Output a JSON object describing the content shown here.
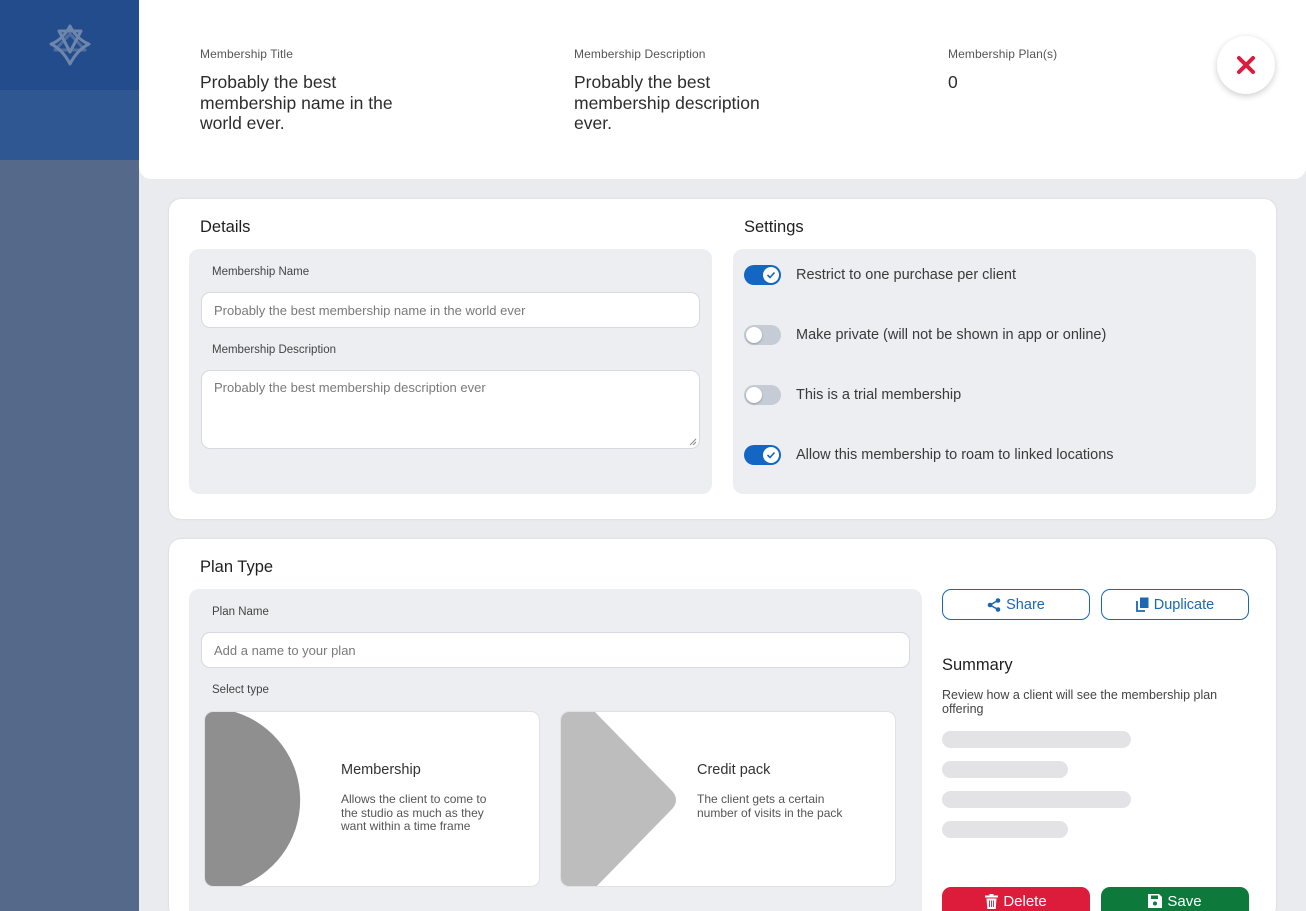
{
  "header": {
    "title_label": "Membership Title",
    "title_value": "Probably the best membership name in the world ever.",
    "desc_label": "Membership Description",
    "desc_value": "Probably the best membership description ever.",
    "plans_label": "Membership Plan(s)",
    "plans_value": "0"
  },
  "details": {
    "heading": "Details",
    "name_label": "Membership Name",
    "name_placeholder": "Probably the best membership name in the world ever",
    "desc_label": "Membership Description",
    "desc_placeholder": "Probably the best membership description ever"
  },
  "settings": {
    "heading": "Settings",
    "items": [
      {
        "label": "Restrict to one purchase per client",
        "enabled": true
      },
      {
        "label": "Make private (will not be shown in app or online)",
        "enabled": false
      },
      {
        "label": "This is a trial membership",
        "enabled": false
      },
      {
        "label": "Allow this membership to roam to linked locations",
        "enabled": true
      }
    ]
  },
  "plan": {
    "heading": "Plan Type",
    "name_label": "Plan Name",
    "name_placeholder": "Add a name to your plan",
    "select_label": "Select type",
    "types": [
      {
        "title": "Membership",
        "description": "Allows the client to come to the studio as much as they want within a time frame"
      },
      {
        "title": "Credit pack",
        "description": "The client gets a certain number of visits in the pack"
      }
    ]
  },
  "actions": {
    "share_label": "Share",
    "duplicate_label": "Duplicate",
    "delete_label": "Delete",
    "save_label": "Save"
  },
  "summary": {
    "heading": "Summary",
    "description": "Review how a client will see the membership plan offering"
  },
  "colors": {
    "accent": "#1366c4",
    "delete": "#dc1c3a",
    "save": "#0d7a3c",
    "sidebar": "#55698b"
  }
}
